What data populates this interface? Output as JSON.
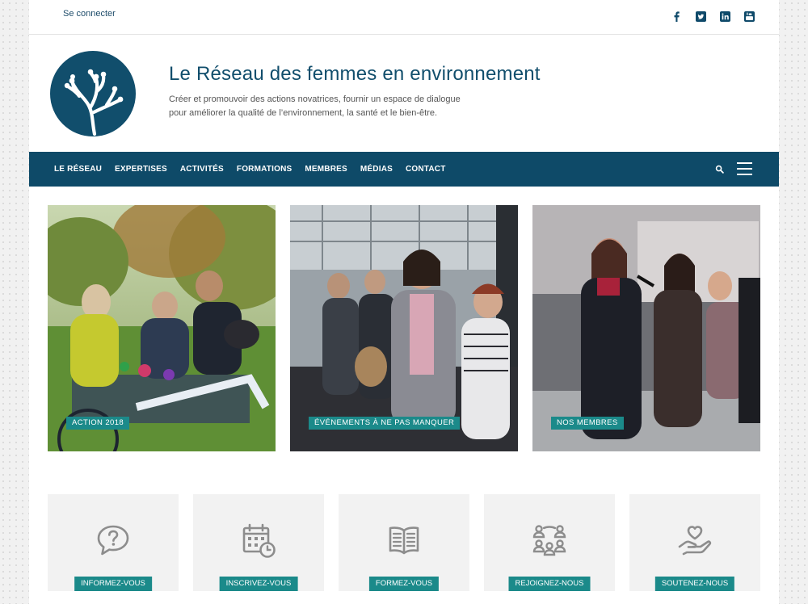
{
  "topbar": {
    "login": "Se connecter",
    "socials": [
      {
        "icon": "facebook-icon"
      },
      {
        "icon": "twitter-icon"
      },
      {
        "icon": "linkedin-icon"
      },
      {
        "icon": "youtube-icon"
      }
    ]
  },
  "header": {
    "title": "Le Réseau des femmes en environnement",
    "tagline_line1": "Créer et promouvoir des actions novatrices, fournir un espace de dialogue",
    "tagline_line2": "pour améliorer la qualité de l’environnement, la santé et le bien-être."
  },
  "nav": {
    "items": [
      "LE RÉSEAU",
      "EXPERTISES",
      "ACTIVITÉS",
      "FORMATIONS",
      "MEMBRES",
      "MÉDIAS",
      "CONTACT"
    ]
  },
  "features": [
    {
      "label": "ACTION 2018"
    },
    {
      "label": "ÉVÉNEMENTS À NE PAS MANQUER"
    },
    {
      "label": "NOS MEMBRES"
    }
  ],
  "tiles": [
    {
      "label": "INFORMEZ-VOUS",
      "icon": "question-bubble-icon"
    },
    {
      "label": "INSCRIVEZ-VOUS",
      "icon": "calendar-clock-icon"
    },
    {
      "label": "FORMEZ-VOUS",
      "icon": "open-book-icon"
    },
    {
      "label": "REJOIGNEZ-NOUS",
      "icon": "people-network-icon"
    },
    {
      "label": "SOUTENEZ-NOUS",
      "icon": "heart-hand-icon"
    }
  ],
  "colors": {
    "brand": "#114e6c",
    "nav_bg": "#0e4a68",
    "accent": "#1b8a8a",
    "tile_bg": "#f2f2f2",
    "icon_gray": "#8d8d8d"
  }
}
